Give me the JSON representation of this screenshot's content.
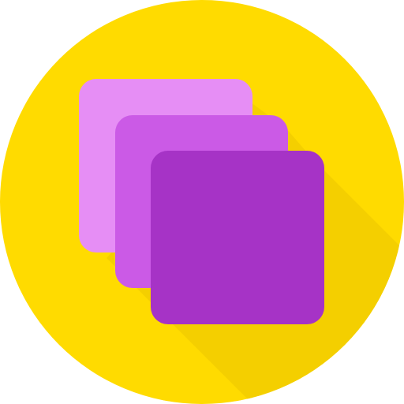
{
  "icon": {
    "name": "layers-icon",
    "colors": {
      "background_circle": "#FFDB00",
      "long_shadow": "#F4CF00",
      "layer_back": "#E68EF5",
      "layer_middle": "#CB5AE6",
      "layer_front": "#A633C6"
    }
  }
}
